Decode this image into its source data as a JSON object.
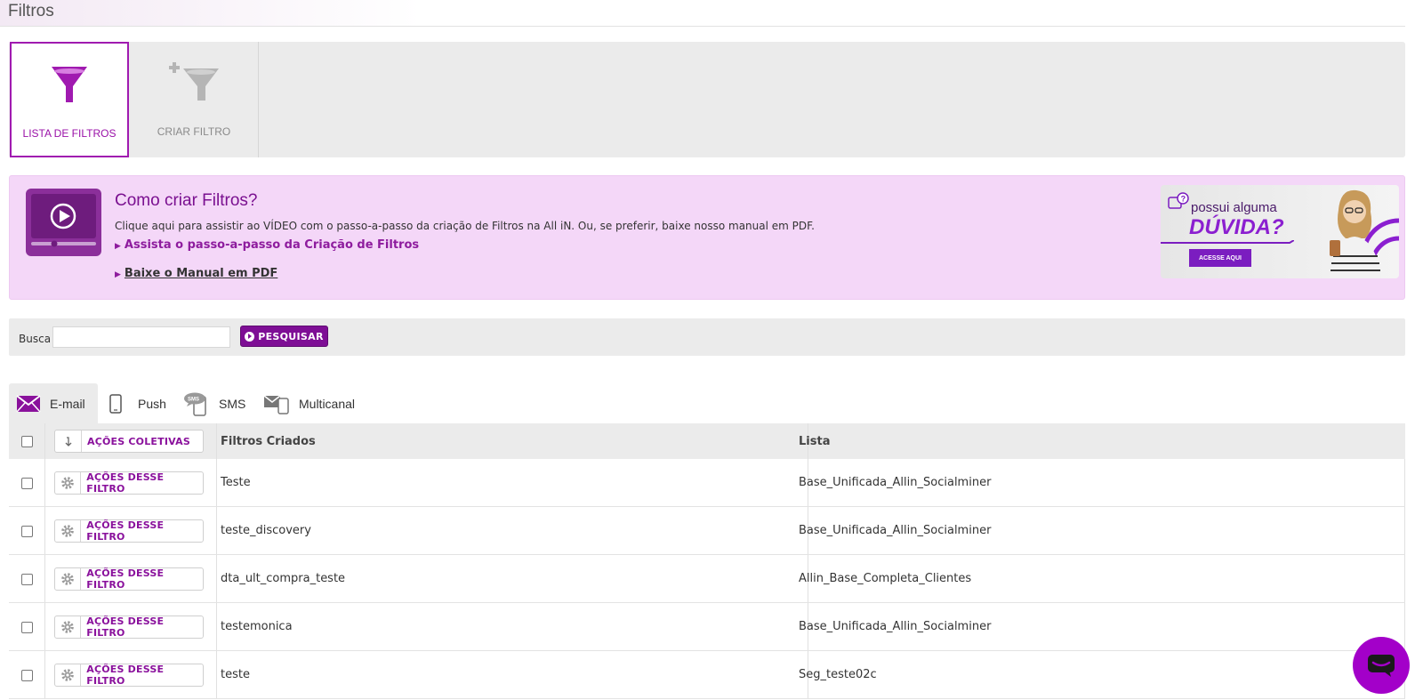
{
  "page": {
    "title": "Filtros"
  },
  "modes": {
    "list_label": "LISTA DE FILTROS",
    "create_label": "CRIAR FILTRO"
  },
  "help": {
    "title": "Como criar Filtros?",
    "description": "Clique aqui para assistir ao VÍDEO com o passo-a-passo da criação de Filtros na All iN. Ou, se preferir, baixe nosso manual em PDF.",
    "video_link": "Assista o passo-a-passo da Criação de Filtros",
    "pdf_link": "Baixe o Manual em PDF",
    "banner": {
      "line1": "possui alguma",
      "line2": "DÚVIDA?",
      "cta": "ACESSE AQUI"
    }
  },
  "search": {
    "label": "Busca",
    "value": "",
    "button": "PESQUISAR"
  },
  "channels": [
    {
      "label": "E-mail",
      "icon": "envelope-icon",
      "active": true
    },
    {
      "label": "Push",
      "icon": "phone-icon",
      "active": false
    },
    {
      "label": "SMS",
      "icon": "sms-icon",
      "active": false
    },
    {
      "label": "Multicanal",
      "icon": "multichannel-icon",
      "active": false
    }
  ],
  "table": {
    "bulk_actions": "AÇÕES COLETIVAS",
    "columns": [
      "Filtros Criados",
      "Lista"
    ],
    "row_action": "AÇÕES DESSE FILTRO",
    "rows": [
      {
        "name": "Teste",
        "list": "Base_Unificada_Allin_Socialminer"
      },
      {
        "name": "teste_discovery",
        "list": "Base_Unificada_Allin_Socialminer"
      },
      {
        "name": "dta_ult_compra_teste",
        "list": "Allin_Base_Completa_Clientes"
      },
      {
        "name": "testemonica",
        "list": "Base_Unificada_Allin_Socialminer"
      },
      {
        "name": "teste",
        "list": "Seg_teste02c"
      }
    ]
  },
  "colors": {
    "accent": "#8a119c",
    "accent_dark": "#7e0e95",
    "help_bg": "#f4d7f8",
    "chat": "#a300c9"
  }
}
